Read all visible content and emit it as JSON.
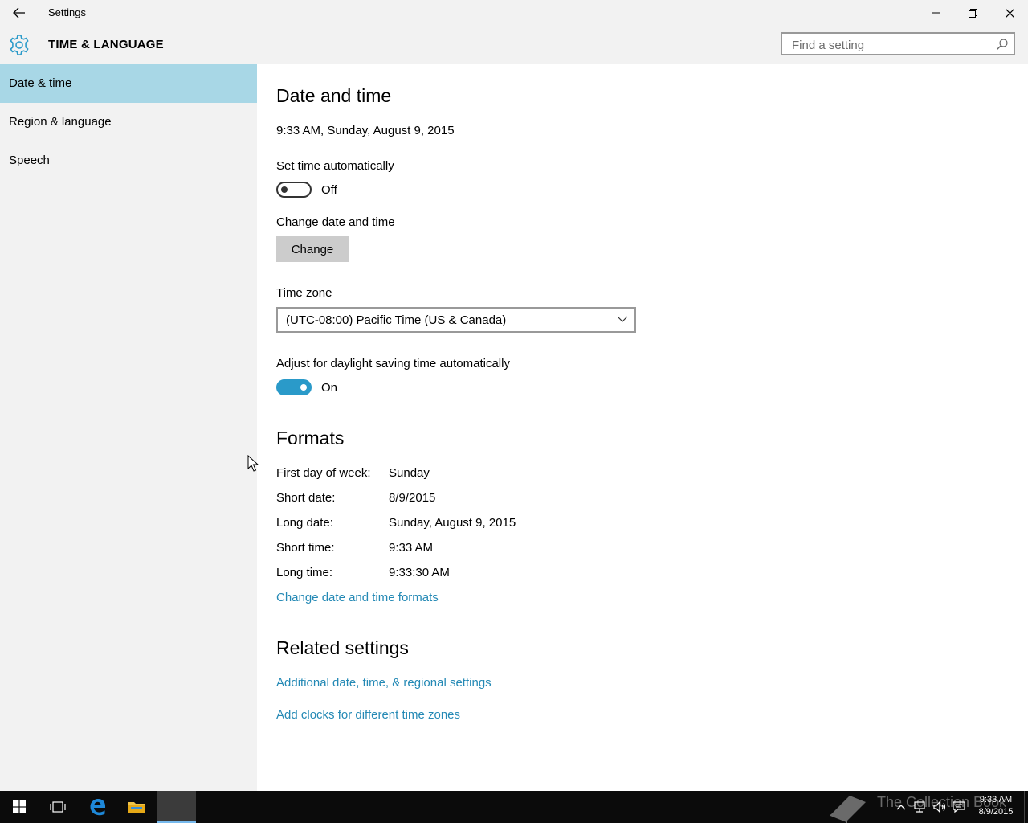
{
  "window": {
    "title": "Settings"
  },
  "header": {
    "section_title": "TIME & LANGUAGE",
    "search_placeholder": "Find a setting"
  },
  "sidebar": {
    "items": [
      {
        "label": "Date & time",
        "active": true
      },
      {
        "label": "Region & language",
        "active": false
      },
      {
        "label": "Speech",
        "active": false
      }
    ]
  },
  "main": {
    "heading": "Date and time",
    "current_datetime": "9:33 AM, Sunday, August 9, 2015",
    "auto_time": {
      "label": "Set time automatically",
      "state": "Off"
    },
    "change_datetime": {
      "label": "Change date and time",
      "button": "Change"
    },
    "time_zone": {
      "label": "Time zone",
      "value": "(UTC-08:00) Pacific Time (US & Canada)"
    },
    "dst": {
      "label": "Adjust for daylight saving time automatically",
      "state": "On"
    },
    "formats": {
      "heading": "Formats",
      "rows": [
        {
          "label": "First day of week:",
          "value": "Sunday"
        },
        {
          "label": "Short date:",
          "value": "8/9/2015"
        },
        {
          "label": "Long date:",
          "value": "Sunday, August 9, 2015"
        },
        {
          "label": "Short time:",
          "value": "9:33 AM"
        },
        {
          "label": "Long time:",
          "value": "9:33:30 AM"
        }
      ],
      "link": "Change date and time formats"
    },
    "related": {
      "heading": "Related settings",
      "links": [
        "Additional date, time, & regional settings",
        "Add clocks for different time zones"
      ]
    }
  },
  "taskbar": {
    "clock_time": "9:33 AM",
    "clock_date": "8/9/2015",
    "watermark": "The Collection Book"
  },
  "colors": {
    "accent": "#2a9ac9",
    "link": "#2489b5",
    "nav_active": "#a8d7e6",
    "chrome": "#f2f2f2"
  }
}
